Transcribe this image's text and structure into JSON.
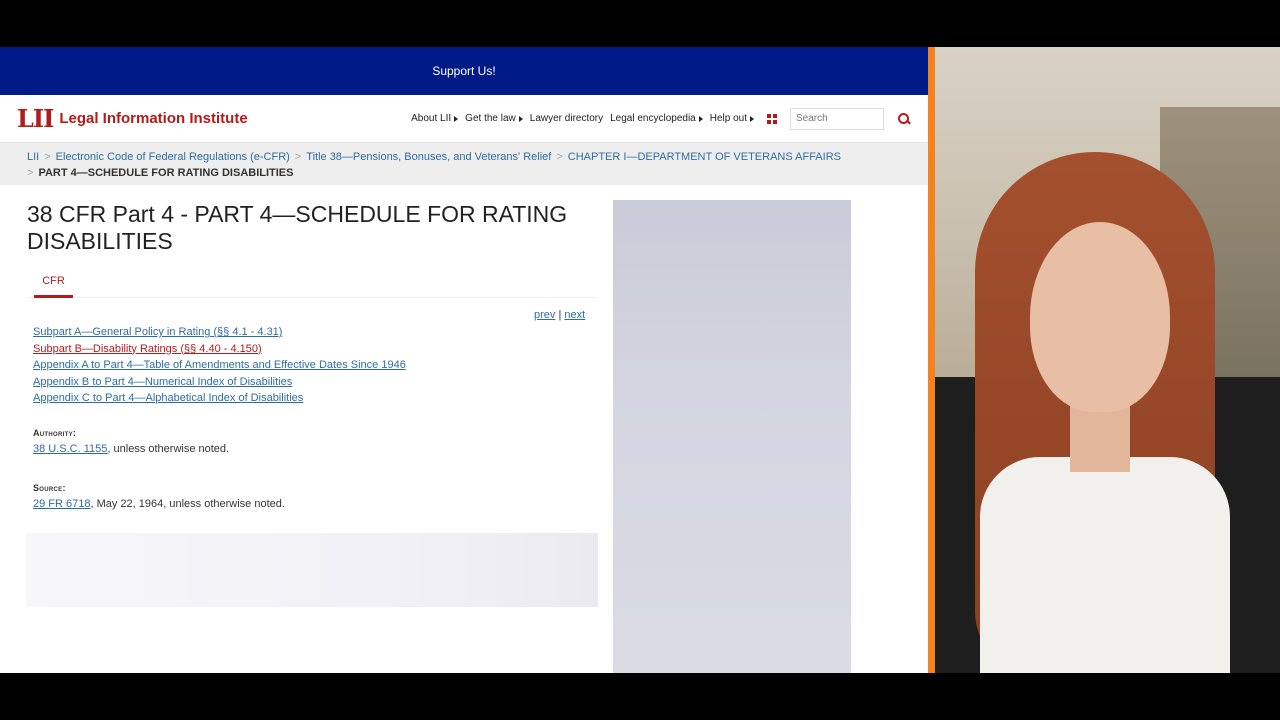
{
  "banner": {
    "text": "Support Us!"
  },
  "header": {
    "logo_mark": "LII",
    "logo_text": "Legal Information Institute",
    "nav": [
      "About LII",
      "Get the law",
      "Lawyer directory",
      "Legal encyclopedia",
      "Help out"
    ],
    "search_placeholder": "Search"
  },
  "breadcrumb": {
    "items": [
      "LII",
      "Electronic Code of Federal Regulations (e-CFR)",
      "Title 38—Pensions, Bonuses, and Veterans' Relief",
      "CHAPTER I—DEPARTMENT OF VETERANS AFFAIRS"
    ],
    "current": "PART 4—SCHEDULE FOR RATING DISABILITIES"
  },
  "page": {
    "title": "38 CFR Part 4 - PART 4—SCHEDULE FOR RATING DISABILITIES",
    "tab": "CFR",
    "prev": "prev",
    "next": "next",
    "pager_sep": "|",
    "toc": [
      "Subpart A—General Policy in Rating (§§ 4.1 - 4.31)",
      "Subpart B—Disability Ratings (§§ 4.40 - 4.150)",
      "Appendix A to Part 4—Table of Amendments and Effective Dates Since 1946",
      "Appendix B to Part 4—Numerical Index of Disabilities",
      "Appendix C to Part 4—Alphabetical Index of Disabilities"
    ],
    "authority_label": "Authority:",
    "authority_link": "38 U.S.C. 1155",
    "authority_rest": ", unless otherwise noted.",
    "source_label": "Source:",
    "source_link": "29 FR 6718",
    "source_rest": ", May 22, 1964, unless otherwise noted."
  },
  "colors": {
    "banner": "#001b87",
    "brand": "#b31b1b",
    "link": "#2e6da4",
    "divider": "#f58220"
  }
}
